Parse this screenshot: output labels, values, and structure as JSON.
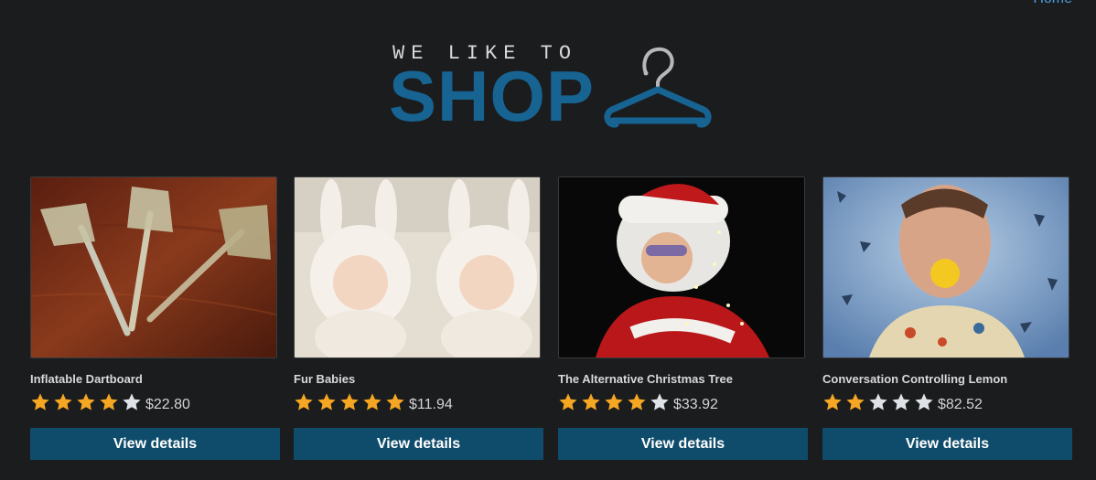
{
  "nav": {
    "home_label": "Home"
  },
  "logo": {
    "tagline": "WE LIKE TO",
    "wordmark": "SHOP",
    "icon": "hanger-icon"
  },
  "colors": {
    "background": "#1b1c1e",
    "brand": "#176392",
    "button": "#0f4c6b",
    "star_filled": "#f5a623",
    "star_empty": "#dfe3e8",
    "link": "#4a9fe0"
  },
  "products": [
    {
      "name": "Inflatable Dartboard",
      "rating": 4,
      "max_rating": 5,
      "price": "$22.80",
      "button_label": "View details",
      "image": "darts-photo"
    },
    {
      "name": "Fur Babies",
      "rating": 5,
      "max_rating": 5,
      "price": "$11.94",
      "button_label": "View details",
      "image": "babies-in-bunny-suits-photo"
    },
    {
      "name": "The Alternative Christmas Tree",
      "rating": 4,
      "max_rating": 5,
      "price": "$33.92",
      "button_label": "View details",
      "image": "santa-with-lights-photo"
    },
    {
      "name": "Conversation Controlling Lemon",
      "rating": 2,
      "max_rating": 5,
      "price": "$82.52",
      "button_label": "View details",
      "image": "man-with-lemon-photo"
    }
  ]
}
